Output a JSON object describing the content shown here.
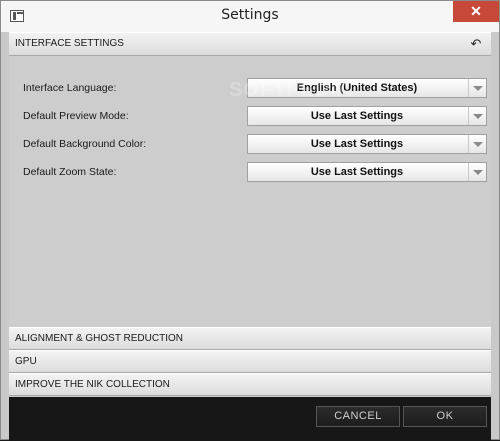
{
  "window": {
    "title": "Settings",
    "close_label": "✕",
    "app_icon": "app-window-icon"
  },
  "sections": {
    "interface": {
      "label": "INTERFACE SETTINGS",
      "reset_icon": "undo-icon"
    },
    "alignment": {
      "label": "ALIGNMENT & GHOST REDUCTION"
    },
    "gpu": {
      "label": "GPU"
    },
    "improve": {
      "label": "IMPROVE THE NIK COLLECTION"
    }
  },
  "settings": [
    {
      "label": "Interface Language:",
      "value": "English (United States)"
    },
    {
      "label": "Default Preview Mode:",
      "value": "Use Last Settings"
    },
    {
      "label": "Default Background Color:",
      "value": "Use Last Settings"
    },
    {
      "label": "Default Zoom State:",
      "value": "Use Last Settings"
    }
  ],
  "footer": {
    "cancel_label": "CANCEL",
    "ok_label": "OK"
  },
  "watermark": "SOFTPEDIA",
  "colors": {
    "panel": "#c9c9c9",
    "footer": "#171717",
    "close": "#c7493a"
  }
}
